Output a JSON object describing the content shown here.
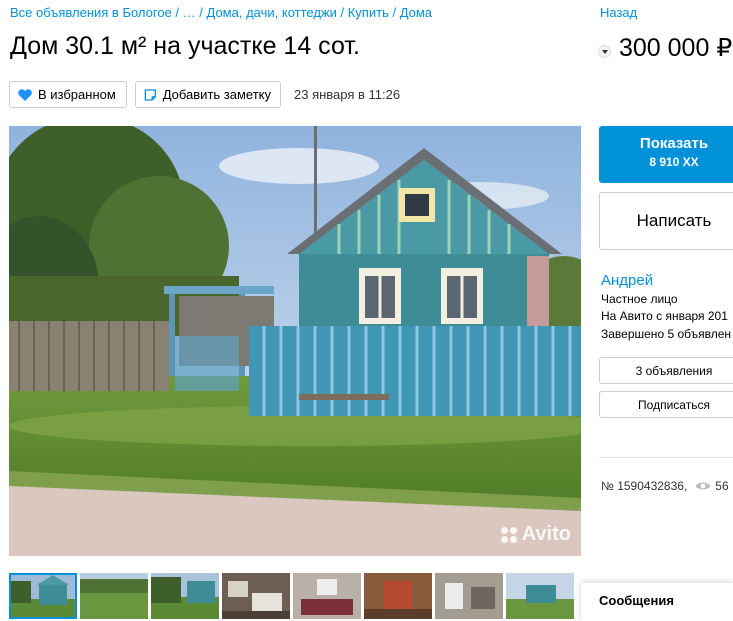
{
  "breadcrumb": {
    "items": [
      "Все объявления в Бологое",
      "…",
      "Дома, дачи, коттеджи",
      "Купить",
      "Дома"
    ],
    "separator": " / "
  },
  "back_label": "Назад",
  "title": "Дом 30.1 м² на участке 14 сот.",
  "price": "300 000 ₽",
  "actions": {
    "favorite_label": "В избранном",
    "note_label": "Добавить заметку",
    "date": "23 января в 11:26"
  },
  "watermark": "Avito",
  "thumbnails_count": 8,
  "contact": {
    "show_phone_label": "Показать",
    "phone_partial": "8 910 ХХ",
    "write_label": "Написать"
  },
  "seller": {
    "name": "Андрей",
    "type": "Частное лицо",
    "since": "На Авито с января 201",
    "completed": "Завершено 5 объявлен",
    "ads_button": "3 объявления",
    "subscribe_button": "Подписаться"
  },
  "listing": {
    "id_text": "№ 1590432836,",
    "views": "56"
  },
  "messages_label": "Сообщения",
  "colors": {
    "accent": "#0091d9",
    "heart": "#1e90ff"
  }
}
